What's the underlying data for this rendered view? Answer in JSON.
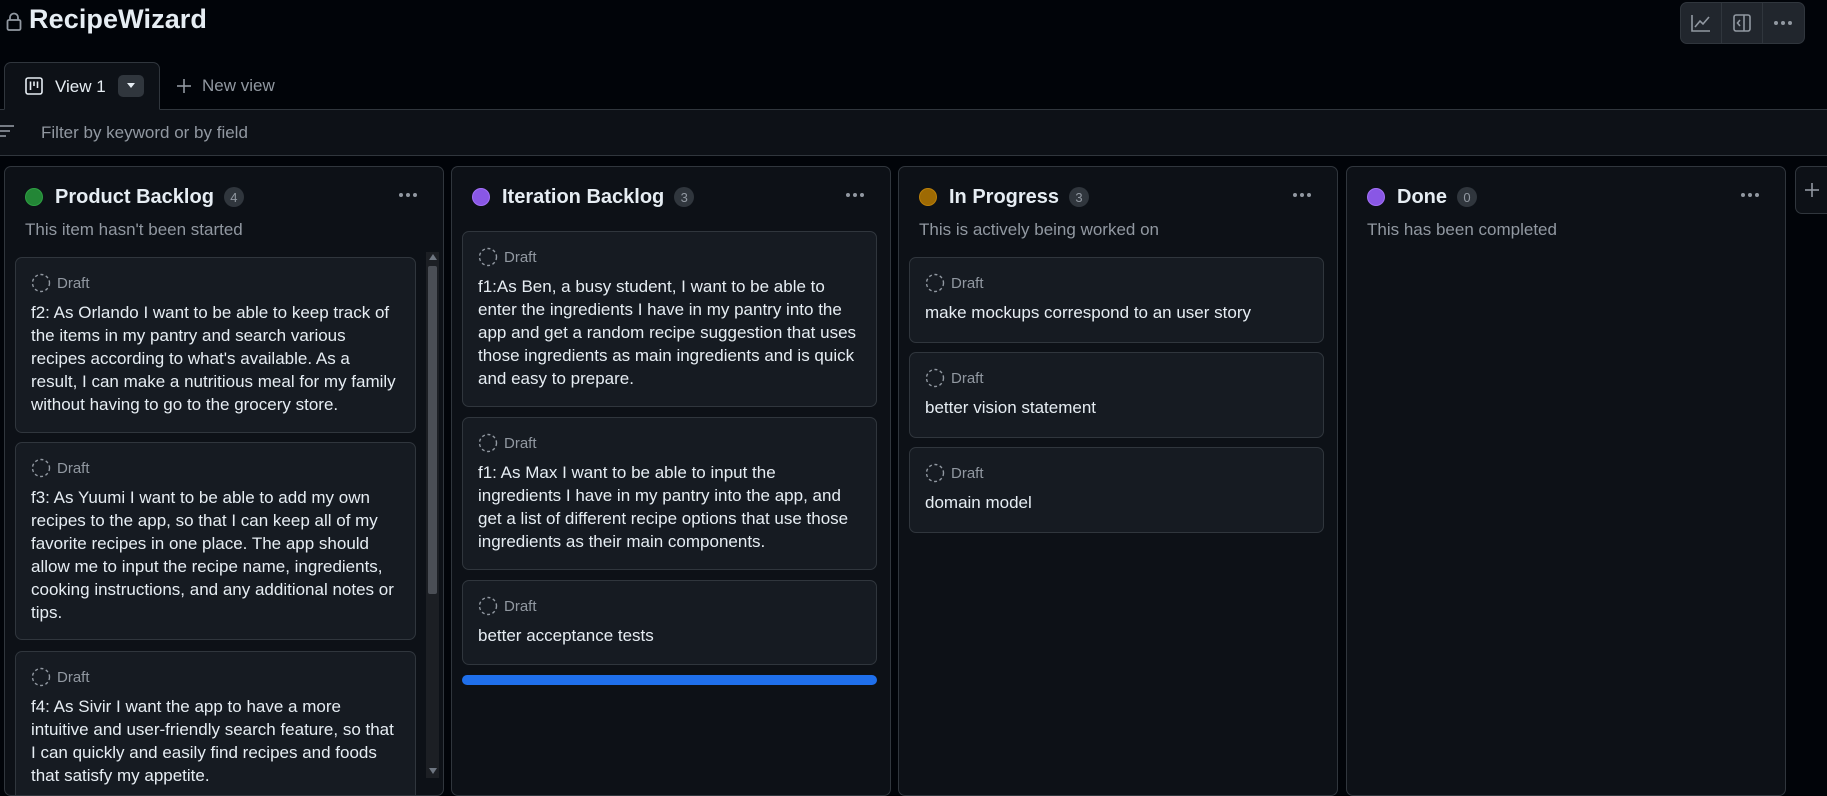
{
  "project": {
    "title": "RecipeWizard"
  },
  "top_actions": [
    {
      "icon": "insights-graph-icon"
    },
    {
      "icon": "side-panel-icon"
    },
    {
      "icon": "kebab-horizontal-icon"
    }
  ],
  "views": {
    "active_label": "View 1",
    "new_view_label": "New view"
  },
  "filter": {
    "placeholder": "Filter by keyword or by field"
  },
  "colors": {
    "backlog": "#238636",
    "iteration": "#8957e5",
    "progress": "#9e6a03",
    "done": "#8957e5",
    "drop_indicator": "#1f6feb"
  },
  "columns": [
    {
      "title": "Product Backlog",
      "count": "4",
      "description": "This item hasn't been started",
      "cards": [
        {
          "status": "Draft",
          "text": "f2: As Orlando I want to be able to keep track of the items in my pantry and search various recipes according to what's available. As a result, I can make a nutritious meal for my family without having to go to the grocery store."
        },
        {
          "status": "Draft",
          "text": "f3: As Yuumi I want to be able to add my own recipes to the app, so that I can keep all of my favorite recipes in one place. The app should allow me to input the recipe name, ingredients, cooking instructions, and any additional notes or tips."
        },
        {
          "status": "Draft",
          "text": "f4: As Sivir I want the app to have a more intuitive and user-friendly search feature, so that I can quickly and easily find recipes and foods that satisfy my appetite."
        }
      ]
    },
    {
      "title": "Iteration Backlog",
      "count": "3",
      "description": "",
      "cards": [
        {
          "status": "Draft",
          "text": "f1:As Ben, a busy student, I want to be able to enter the ingredients I have in my pantry into the app and get a random recipe suggestion that uses those ingredients as main ingredients and is quick and easy to prepare."
        },
        {
          "status": "Draft",
          "text": "f1: As Max I want to be able to input the ingredients I have in my pantry into the app, and get a list of different recipe options that use those ingredients as their main components."
        },
        {
          "status": "Draft",
          "text": "better acceptance tests"
        }
      ]
    },
    {
      "title": "In Progress",
      "count": "3",
      "description": "This is actively being worked on",
      "cards": [
        {
          "status": "Draft",
          "text": "make mockups correspond to an user story"
        },
        {
          "status": "Draft",
          "text": "better vision statement"
        },
        {
          "status": "Draft",
          "text": "domain model"
        }
      ]
    },
    {
      "title": "Done",
      "count": "0",
      "description": "This has been completed",
      "cards": []
    }
  ]
}
